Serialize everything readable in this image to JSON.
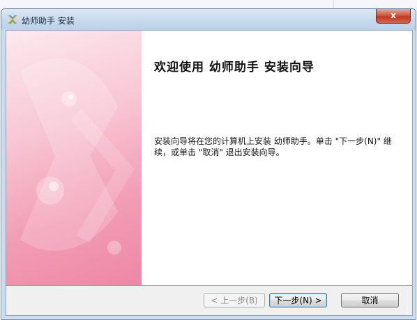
{
  "window": {
    "title": "幼师助手 安装",
    "close_label": "x"
  },
  "main": {
    "welcome_heading": "欢迎使用 幼师助手 安装向导",
    "description": "安装向导将在您的计算机上安装 幼师助手。单击 \"下一步(N)\" 继续，或单击 \"取消\" 退出安装向导。"
  },
  "footer": {
    "back_label": "< 上一步(B)",
    "next_label": "下一步(N) >",
    "cancel_label": "取消"
  },
  "colors": {
    "banner_pink": "#f29db5",
    "titlebar": "#c5d8ec",
    "close_red": "#cf5a43"
  }
}
